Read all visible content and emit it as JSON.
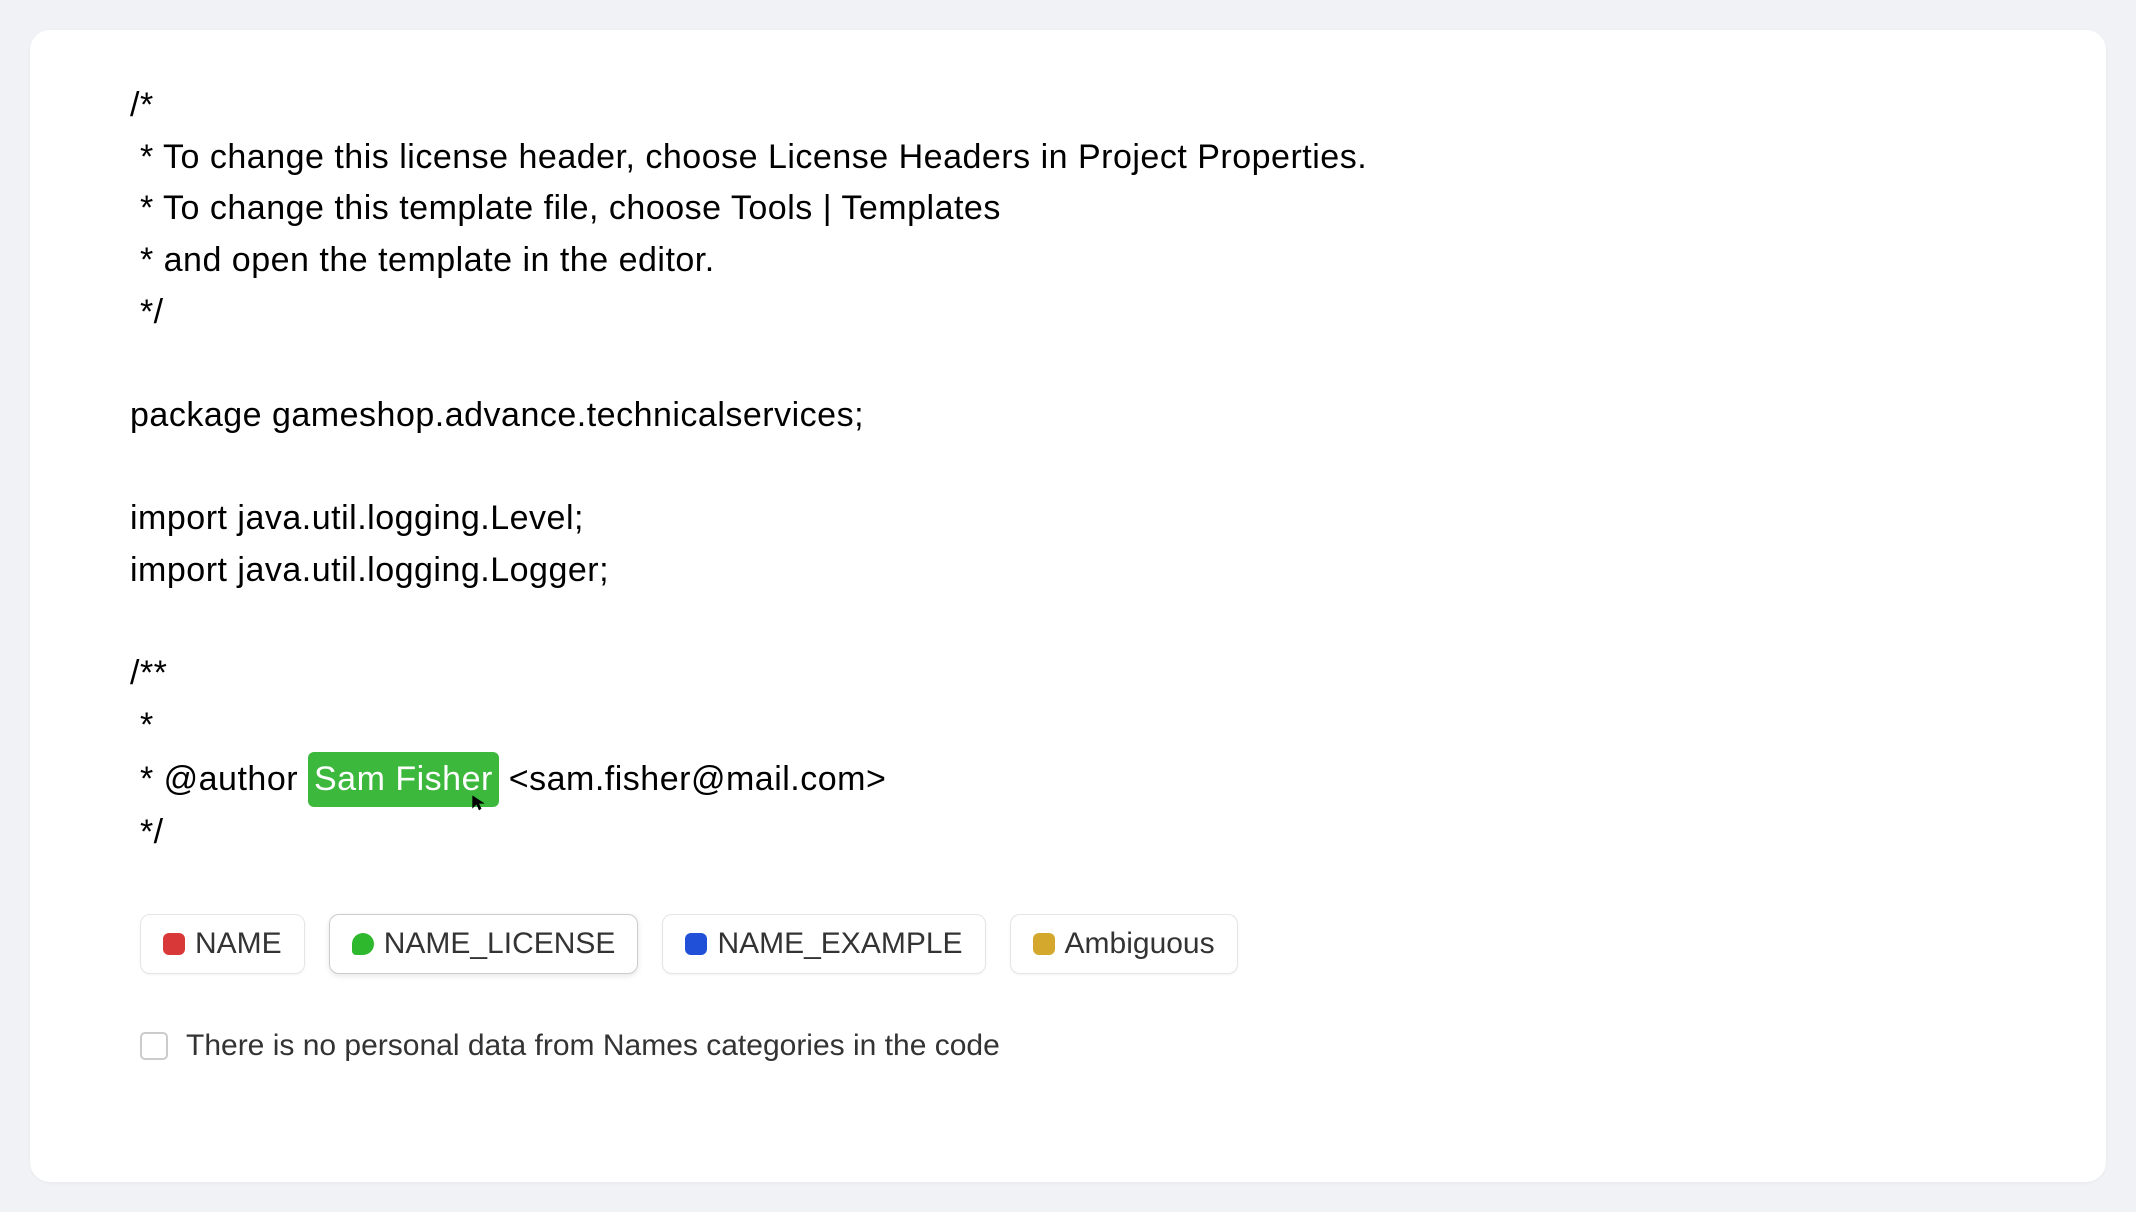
{
  "code": {
    "line1": "/*",
    "line2": " * To change this license header, choose License Headers in Project Properties.",
    "line3": " * To change this template file, choose Tools | Templates",
    "line4": " * and open the template in the editor.",
    "line5": " */",
    "line6": "",
    "line7": "package gameshop.advance.technicalservices;",
    "line8": "",
    "line9": "import java.util.logging.Level;",
    "line10": "import java.util.logging.Logger;",
    "line11": "",
    "line12": "/**",
    "line13": " *",
    "author_prefix": " * @author ",
    "author_name": "Sam Fisher",
    "author_email": " <sam.fisher@mail.com>",
    "line15": " */"
  },
  "labels": {
    "name": {
      "text": "NAME",
      "color": "#d93838"
    },
    "name_license": {
      "text": "NAME_LICENSE",
      "color": "#2eb82e"
    },
    "name_example": {
      "text": "NAME_EXAMPLE",
      "color": "#2050d8"
    },
    "ambiguous": {
      "text": "Ambiguous",
      "color": "#d4a82c"
    }
  },
  "checkbox": {
    "label": "There is no personal data from Names categories in the code",
    "checked": false
  }
}
